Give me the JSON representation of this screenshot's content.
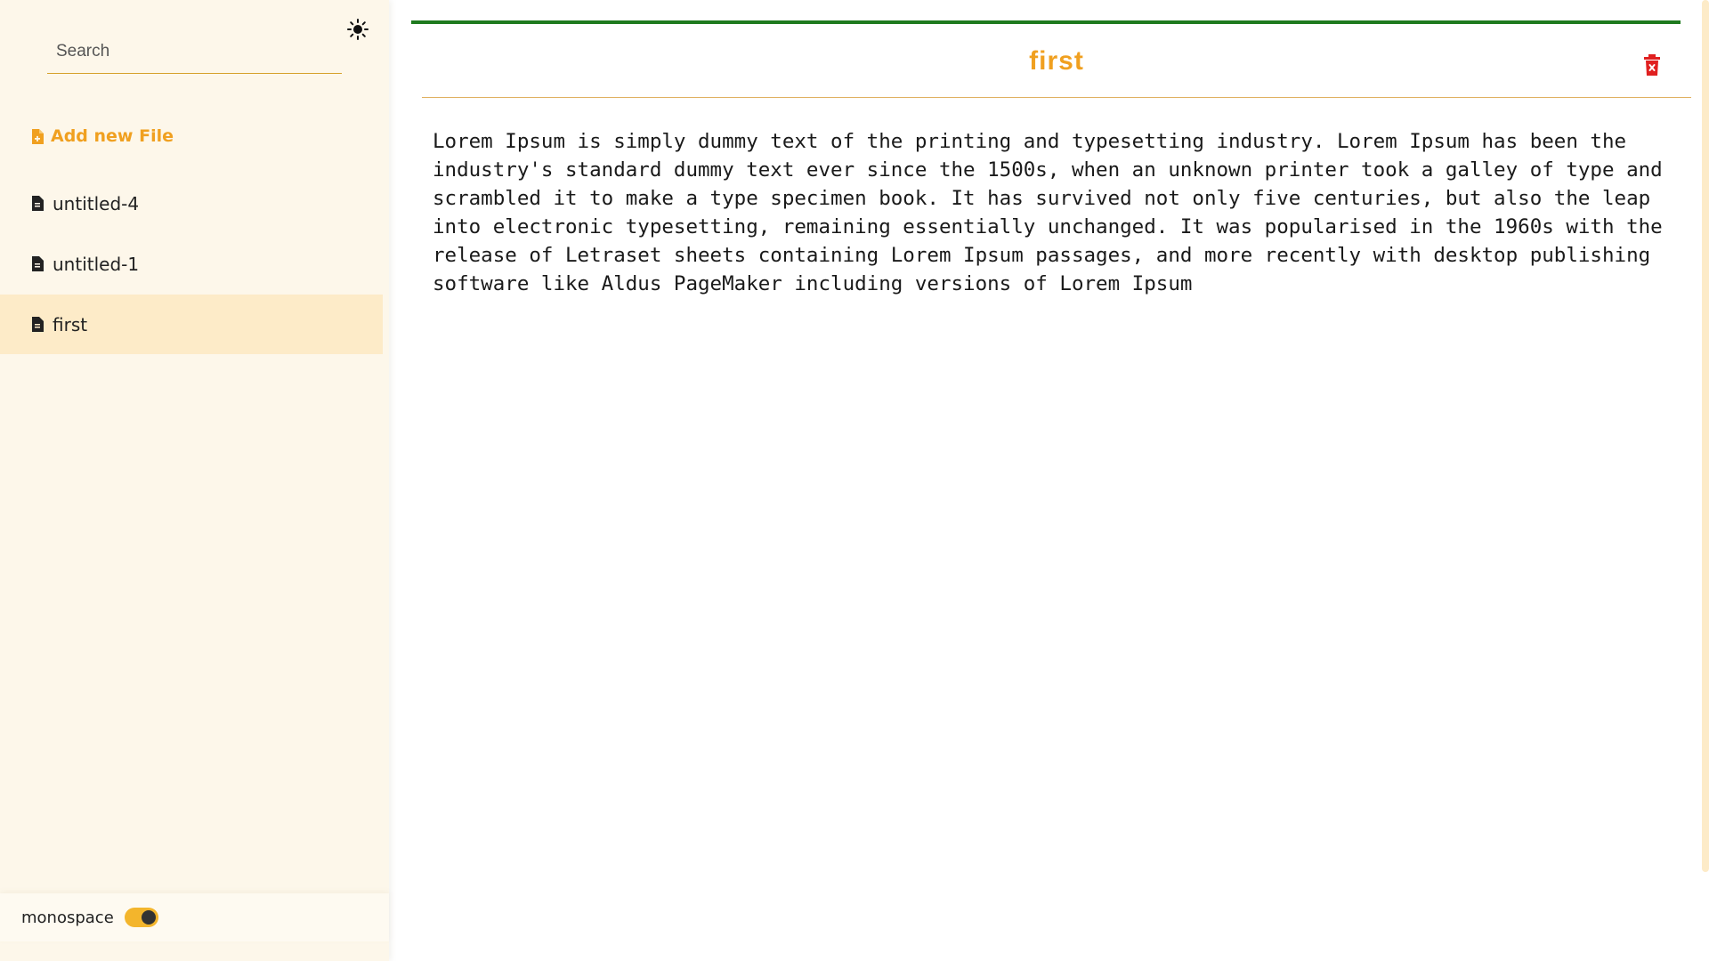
{
  "sidebar": {
    "search": {
      "placeholder": "Search",
      "value": ""
    },
    "theme_icon": "sun-icon",
    "add_file_label": "Add new File",
    "add_file_icon": "file-add-icon",
    "files": [
      {
        "label": "untitled-4",
        "icon": "file-icon",
        "active": false
      },
      {
        "label": "untitled-1",
        "icon": "file-icon",
        "active": false
      },
      {
        "label": "first",
        "icon": "file-icon",
        "active": true
      }
    ],
    "footer": {
      "label": "monospace",
      "toggle_on": true
    }
  },
  "editor": {
    "progress": 1.0,
    "title": "first",
    "delete_icon": "trash-icon",
    "body": "Lorem Ipsum is simply dummy text of the printing and typesetting industry. Lorem Ipsum has been the industry's standard dummy text ever since the 1500s, when an unknown printer took a galley of type and scrambled it to make a type specimen book. It has survived not only five centuries, but also the leap into electronic typesetting, remaining essentially unchanged. It was popularised in the 1960s with the release of Letraset sheets containing Lorem Ipsum passages, and more recently with desktop publishing software like Aldus PageMaker including versions of Lorem Ipsum"
  },
  "colors": {
    "accent": "#f0a020",
    "sidebar_bg": "#fdf7ea",
    "active_item": "#fdebc8",
    "progress": "#1e7a1e",
    "danger": "#e02020"
  }
}
